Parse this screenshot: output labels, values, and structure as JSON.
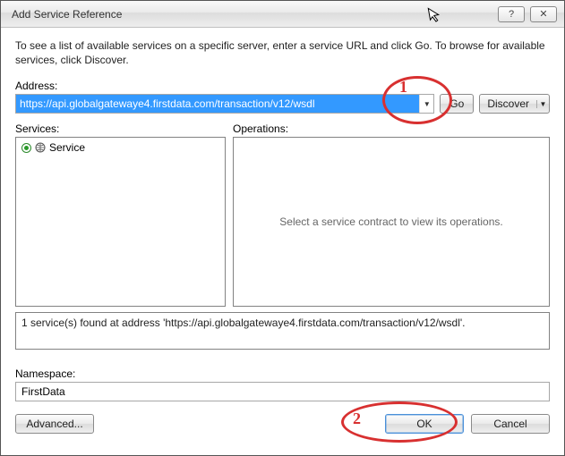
{
  "window": {
    "title": "Add Service Reference",
    "help_glyph": "?",
    "close_glyph": "✕"
  },
  "instructions": "To see a list of available services on a specific server, enter a service URL and click Go. To browse for available services, click Discover.",
  "address": {
    "label": "Address:",
    "value": "https://api.globalgatewaye4.firstdata.com/transaction/v12/wsdl",
    "go_label": "Go",
    "discover_label": "Discover"
  },
  "panels": {
    "services_label": "Services:",
    "operations_label": "Operations:",
    "service_item": "Service",
    "operations_placeholder": "Select a service contract to view its operations."
  },
  "status": "1 service(s) found at address 'https://api.globalgatewaye4.firstdata.com/transaction/v12/wsdl'.",
  "namespace": {
    "label": "Namespace:",
    "value": "FirstData"
  },
  "footer": {
    "advanced_label": "Advanced...",
    "ok_label": "OK",
    "cancel_label": "Cancel"
  },
  "annotations": {
    "one": "1",
    "two": "2"
  }
}
